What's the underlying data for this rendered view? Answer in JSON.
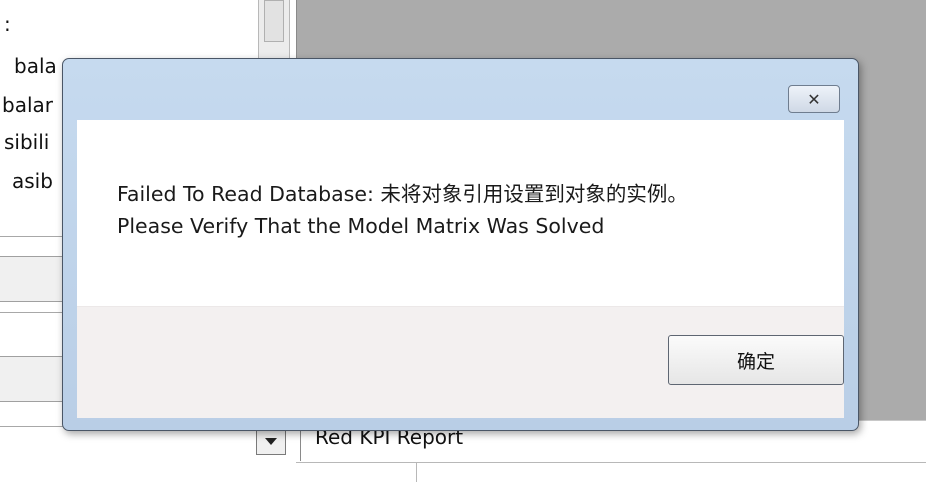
{
  "background": {
    "left_list": [
      {
        "text": ":"
      },
      {
        "text": "bala"
      },
      {
        "text": "balar"
      },
      {
        "text": "sibili"
      },
      {
        "text": "asib"
      }
    ],
    "report_field": {
      "value": "Red KPI Report"
    }
  },
  "dialog": {
    "close_icon": "close-x-icon",
    "message_line1": "Failed To Read Database: 未将对象引用设置到对象的实例。",
    "message_line2": "Please Verify That the Model Matrix Was Solved",
    "ok_label": "确定"
  }
}
